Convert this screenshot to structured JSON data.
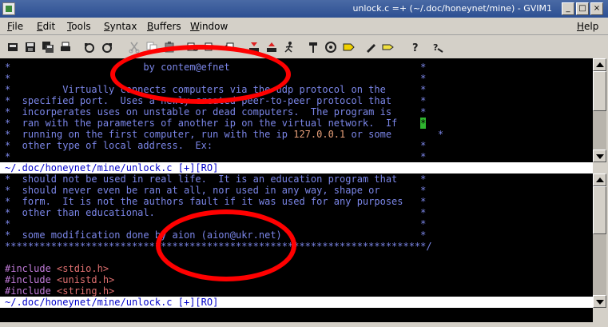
{
  "window": {
    "title": "unlock.c =+ (~/.doc/honeynet/mine) - GVIM1",
    "minimize_glyph": "_",
    "maximize_glyph": "□",
    "close_glyph": "×"
  },
  "menubar": {
    "items": [
      "File",
      "Edit",
      "Tools",
      "Syntax",
      "Buffers",
      "Window"
    ],
    "help": "Help"
  },
  "toolbar": {
    "icons": [
      "open-icon",
      "save-icon",
      "save-all-icon",
      "print-icon",
      "undo-icon",
      "redo-icon",
      "cut-icon",
      "copy-icon",
      "paste-icon",
      "find-replace-icon",
      "find-next-icon",
      "find-prev-icon",
      "load-session-icon",
      "save-session-icon",
      "run-script-icon",
      "make-icon",
      "build-tags-icon",
      "jump-tag-icon",
      "help-icon",
      "find-help-icon"
    ]
  },
  "editor": {
    "top_pane": {
      "lines": [
        "*                       by contem@efnet                                 *",
        "*                                                                       *",
        "*         Virtually connects computers via the udp protocol on the      *",
        "*  specified port.  Uses a newly created peer-to-peer protocol that     *",
        "*  incorperates uses on unstable or dead computers.  The program is     *",
        "*  ran with the parameters of another ip on the virtual network.  If    ",
        "*  running on the first computer, run with the ip ",
        "*  other type of local address.  Ex:                                    *",
        "*                                                                       *"
      ],
      "line6_end": "*",
      "line7_ip": "127.0.0.1",
      "line7_tail": " or some        *",
      "status": "~/.doc/honeynet/mine/unlock.c [+][RO]"
    },
    "bottom_pane": {
      "lines": [
        "*  should not be used in real life.  It is an education program that    *",
        "*  should never even be ran at all, nor used in any way, shape or       *",
        "*  form.  It is not the authors fault if it was used for any purposes   *",
        "*  other than educational.                                              *",
        "*                                                                       *",
        "*  some modification done by aion (aion@ukr.net)                        *",
        "*************************************************************************/",
        ""
      ],
      "includes": [
        {
          "kw": "#include",
          "hdr": "<stdio.h>"
        },
        {
          "kw": "#include",
          "hdr": "<unistd.h>"
        },
        {
          "kw": "#include",
          "hdr": "<string.h>"
        }
      ],
      "status": "~/.doc/honeynet/mine/unlock.c [+][RO]"
    }
  },
  "colors": {
    "comment": "#7b86e8",
    "preproc": "#c07ad8",
    "header": "#e07070",
    "number": "#e8a07a",
    "annotation": "#ff0000",
    "cursor": "#2fb52f"
  }
}
